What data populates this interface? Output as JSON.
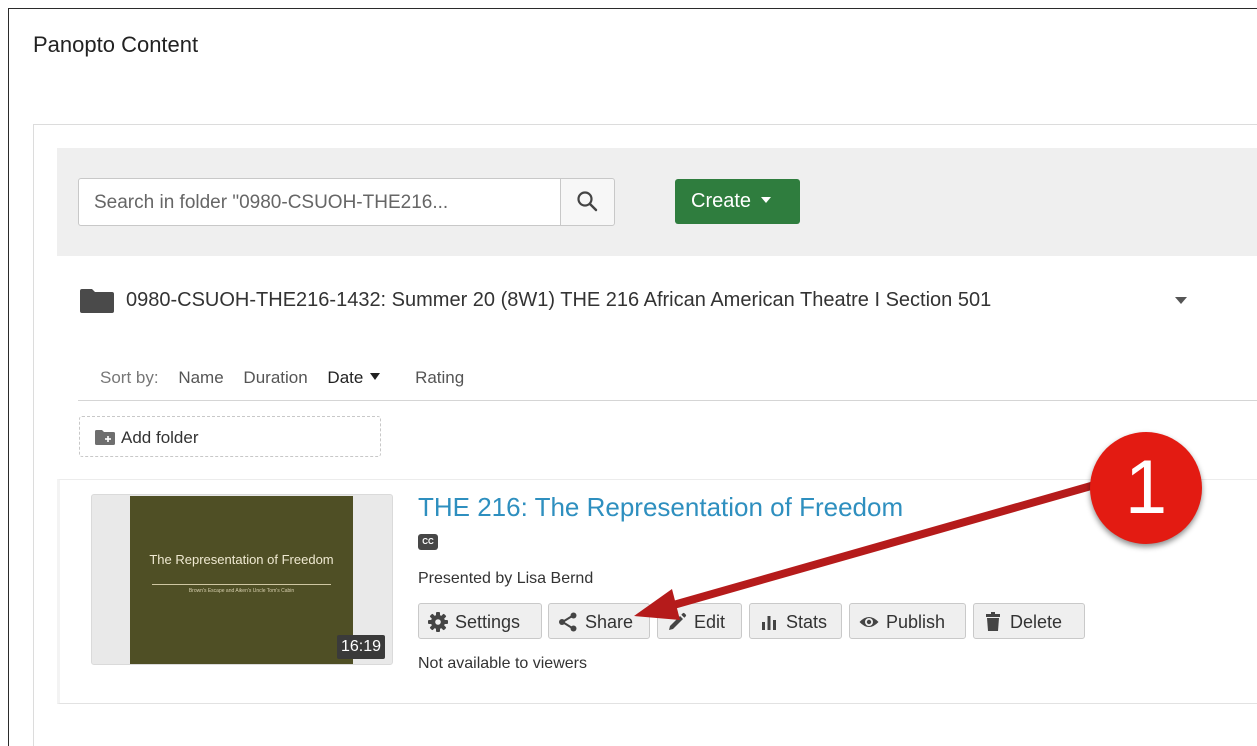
{
  "page": {
    "title": "Panopto Content"
  },
  "toolbar": {
    "search_placeholder": "Search in folder \"0980-CSUOH-THE216...",
    "search_icon": "search-icon",
    "create_label": "Create"
  },
  "folder": {
    "name": "0980-CSUOH-THE216-1432: Summer 20 (8W1) THE 216 African American Theatre I Section 501",
    "icon": "folder-icon"
  },
  "sort": {
    "label": "Sort by:",
    "options": [
      "Name",
      "Duration",
      "Date",
      "Rating"
    ],
    "active": "Date"
  },
  "add_folder": {
    "label": "Add folder"
  },
  "session": {
    "title": "THE 216: The Representation of Freedom",
    "cc_label": "CC",
    "presenter": "Presented by Lisa Bernd",
    "duration": "16:19",
    "thumbnail": {
      "title": "The Representation of Freedom",
      "subtitle": "Brown's Escape and Aiken's Uncle Tom's Cabin"
    },
    "actions": [
      {
        "label": "Settings",
        "icon": "gear-icon"
      },
      {
        "label": "Share",
        "icon": "share-icon"
      },
      {
        "label": "Edit",
        "icon": "pencil-icon"
      },
      {
        "label": "Stats",
        "icon": "bar-chart-icon"
      },
      {
        "label": "Publish",
        "icon": "eye-icon"
      },
      {
        "label": "Delete",
        "icon": "trash-icon"
      }
    ],
    "availability": "Not available to viewers"
  },
  "annotation": {
    "step_number": "1",
    "color": "#e31b12",
    "arrow_color": "#b51b1b"
  },
  "colors": {
    "create_button": "#2f7d3e",
    "session_title": "#2e8fbf"
  }
}
